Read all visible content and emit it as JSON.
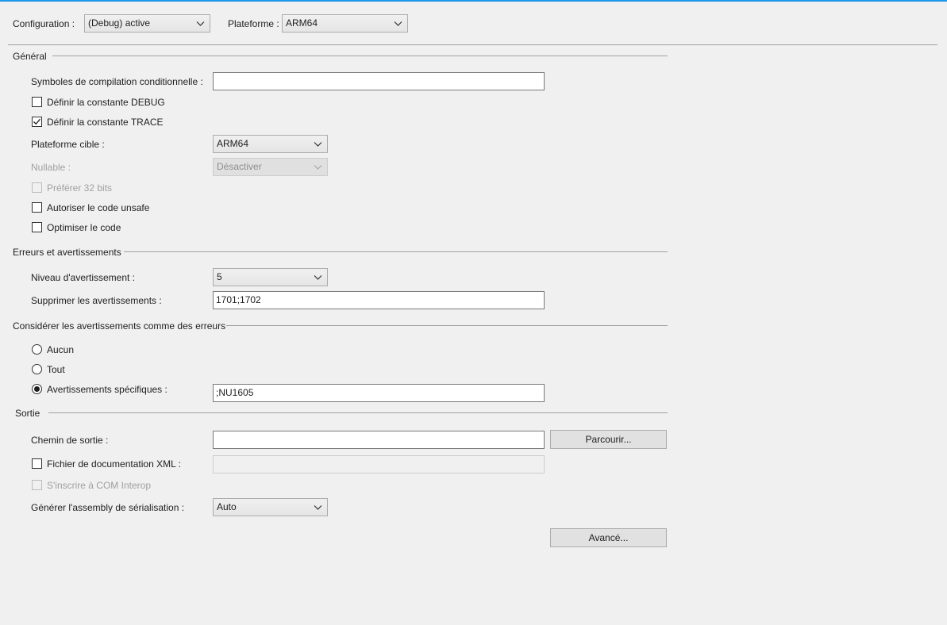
{
  "toolbar": {
    "configuration_label": "Configuration :",
    "configuration_value": "(Debug) active",
    "platform_label": "Plateforme :",
    "platform_value": "ARM64"
  },
  "general": {
    "title": "Général",
    "symbols_label": "Symboles de compilation conditionnelle :",
    "symbols_value": "",
    "define_debug_label": "Définir la constante DEBUG",
    "define_debug_checked": false,
    "define_trace_label": "Définir la constante TRACE",
    "define_trace_checked": true,
    "target_platform_label": "Plateforme cible :",
    "target_platform_value": "ARM64",
    "nullable_label": "Nullable :",
    "nullable_value": "Désactiver",
    "prefer32_label": "Préférer 32 bits",
    "unsafe_label": "Autoriser le code unsafe",
    "optimize_label": "Optimiser le code"
  },
  "errors": {
    "title": "Erreurs et avertissements",
    "warning_level_label": "Niveau d'avertissement :",
    "warning_level_value": "5",
    "suppress_label": "Supprimer les avertissements :",
    "suppress_value": "1701;1702"
  },
  "treat_warnings": {
    "title": "Considérer les avertissements comme des erreurs",
    "none_label": "Aucun",
    "all_label": "Tout",
    "specific_label": "Avertissements spécifiques :",
    "specific_value": ";NU1605",
    "selected": "specific"
  },
  "output": {
    "title": "Sortie",
    "output_path_label": "Chemin de sortie :",
    "output_path_value": "",
    "browse_label": "Parcourir...",
    "xml_doc_label": "Fichier de documentation XML :",
    "xml_doc_value": "",
    "com_interop_label": "S'inscrire à COM Interop",
    "serialization_label": "Générer l'assembly de sérialisation :",
    "serialization_value": "Auto",
    "advanced_label": "Avancé..."
  },
  "colors": {
    "accent": "#1c97ea",
    "background": "#f0f0f0"
  }
}
